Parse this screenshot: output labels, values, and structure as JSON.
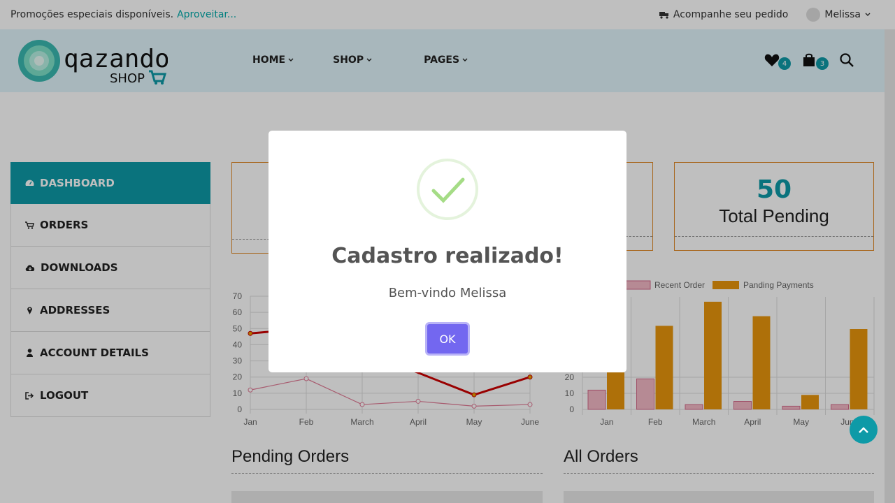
{
  "topbar": {
    "promo_text": "Promoções especiais disponíveis.",
    "promo_link": "Aproveitar...",
    "track_order": "Acompanhe seu pedido",
    "user_name": "Melissa"
  },
  "header": {
    "logo_text": "qazando",
    "logo_sub": "SHOP",
    "nav": [
      {
        "label": "HOME"
      },
      {
        "label": "SHOP"
      },
      {
        "label": "PAGES"
      }
    ],
    "wishlist_count": "4",
    "cart_count": "3"
  },
  "sidebar": {
    "items": [
      {
        "label": "DASHBOARD",
        "icon": "dashboard-icon"
      },
      {
        "label": "ORDERS",
        "icon": "cart-icon"
      },
      {
        "label": "DOWNLOADS",
        "icon": "cloud-download-icon"
      },
      {
        "label": "ADDRESSES",
        "icon": "map-marker-icon"
      },
      {
        "label": "ACCOUNT DETAILS",
        "icon": "user-icon"
      },
      {
        "label": "LOGOUT",
        "icon": "logout-icon"
      }
    ]
  },
  "cards": {
    "pending_value": "50",
    "pending_label": "Total Pending"
  },
  "sections": {
    "pending_orders": "Pending Orders",
    "all_orders": "All Orders"
  },
  "modal": {
    "title": "Cadastro realizado!",
    "message": "Bem-vindo Melissa",
    "ok_label": "OK"
  },
  "chart_data": [
    {
      "type": "line",
      "categories": [
        "Jan",
        "Feb",
        "March",
        "April",
        "May",
        "June"
      ],
      "yticks": [
        0,
        10,
        20,
        30,
        40,
        50,
        60,
        70
      ],
      "ylim": [
        0,
        70
      ],
      "series": [
        {
          "values": [
            47,
            50,
            null,
            null,
            9,
            20
          ],
          "color": "#cc0000"
        },
        {
          "values": [
            12,
            19,
            3,
            5,
            2,
            3
          ],
          "color": "#e07a95"
        }
      ]
    },
    {
      "type": "bar",
      "categories": [
        "Jan",
        "Feb",
        "March",
        "April",
        "May",
        "June"
      ],
      "yticks": [
        0,
        10,
        20
      ],
      "ylim": [
        0,
        70
      ],
      "series": [
        {
          "name": "Recent Order",
          "values": [
            12,
            19,
            3,
            5,
            2,
            3
          ],
          "color": "#f3b8c6"
        },
        {
          "name": "Panding Payments",
          "values": [
            23,
            52,
            67,
            58,
            9,
            50
          ],
          "color": "#e8960c"
        }
      ]
    }
  ]
}
